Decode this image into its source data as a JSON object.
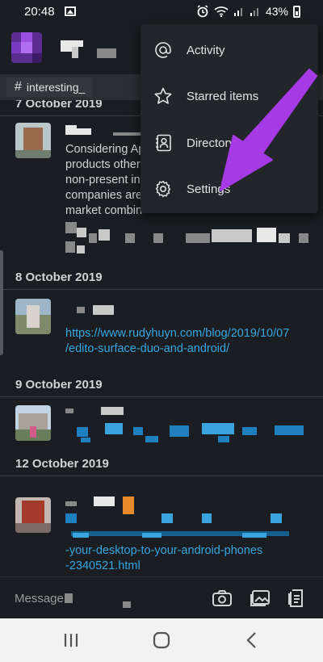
{
  "status_bar": {
    "time": "20:48",
    "battery": "43%",
    "icons": [
      "image-icon",
      "alarm-icon",
      "wifi-icon",
      "signal-icon",
      "signal-icon",
      "battery-icon"
    ]
  },
  "channel": {
    "hash": "#",
    "name": "interesting_"
  },
  "feed": {
    "dates": [
      "7 October 2019",
      "8 October 2019",
      "9 October 2019",
      "12 October 2019"
    ],
    "messages": [
      {
        "lines": [
          "Considering Ap",
          "products other",
          "non-present in",
          "companies are",
          "market combin"
        ]
      },
      {
        "link_lines": [
          "https://www.rudyhuyn.com/blog/2019/10/07",
          "/edito-surface-duo-and-android/"
        ]
      },
      {
        "link_lines": []
      },
      {
        "link_lines": [
          "-your-desktop-to-your-android-phones",
          "-2340521.html"
        ]
      }
    ]
  },
  "menu": {
    "items": [
      {
        "label": "Activity",
        "icon": "at-icon"
      },
      {
        "label": "Starred items",
        "icon": "star-icon"
      },
      {
        "label": "Directory",
        "icon": "directory-icon"
      },
      {
        "label": "Settings",
        "icon": "gear-icon"
      }
    ]
  },
  "composer": {
    "placeholder": "Message",
    "icons": [
      "camera-icon",
      "gallery-icon",
      "files-icon"
    ]
  },
  "nav": {
    "buttons": [
      "recents-button",
      "home-button",
      "back-button"
    ]
  },
  "colors": {
    "background": "#1a1d21",
    "link": "#36a7e0",
    "annotation_arrow": "#a63be6",
    "workspace": "#5b2d90"
  }
}
